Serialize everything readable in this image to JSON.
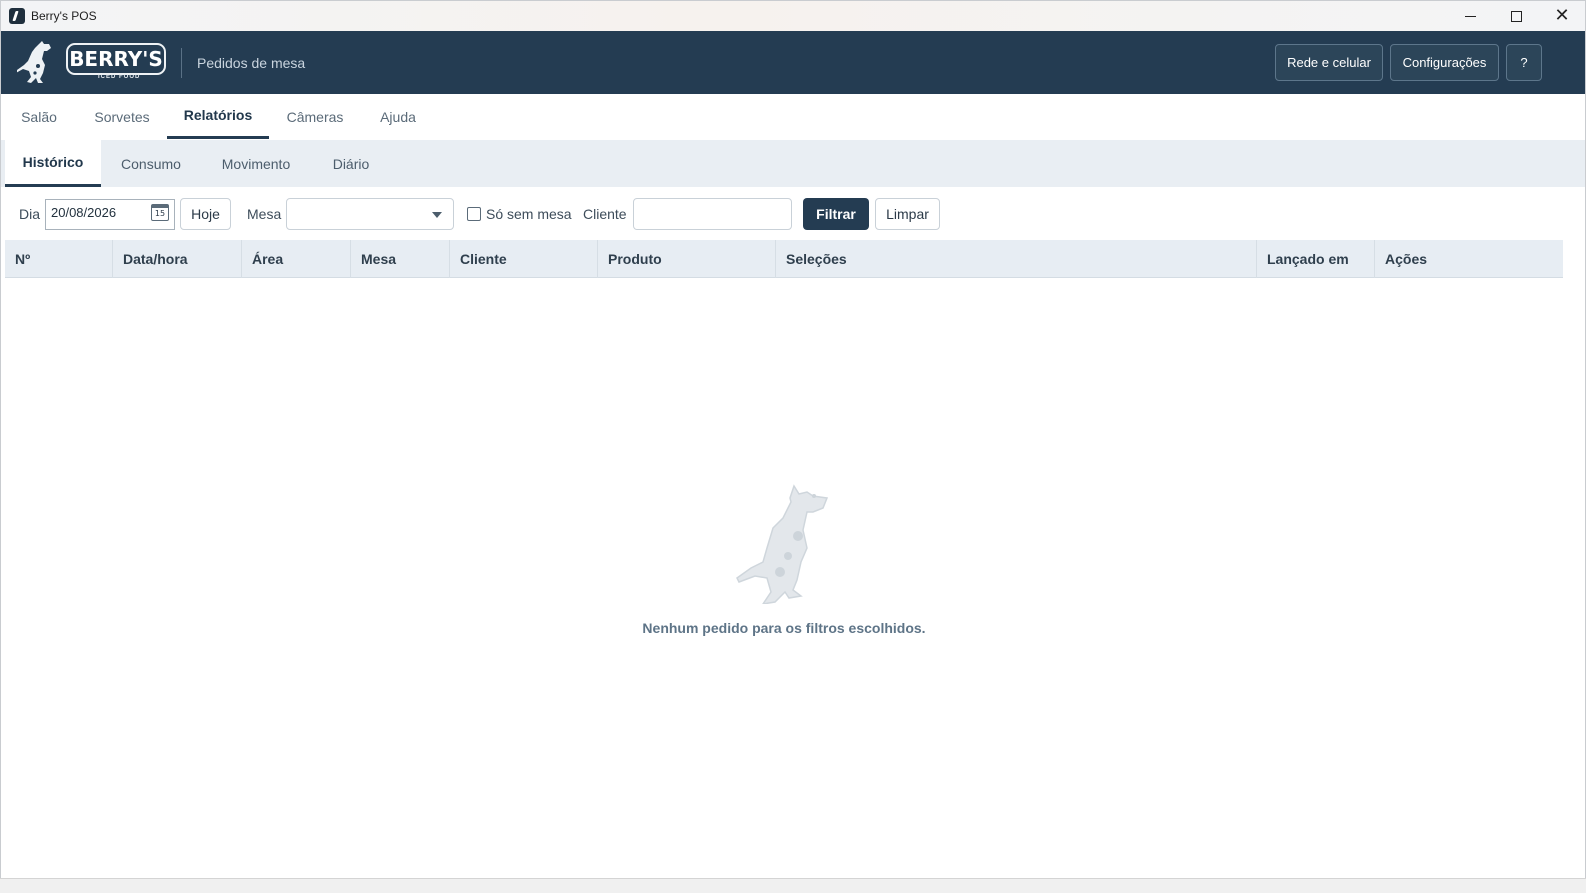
{
  "window": {
    "title": "Berry's POS"
  },
  "header": {
    "logo_text": "BERRY'S",
    "logo_sub": "ICED FOOD",
    "subtitle": "Pedidos de mesa",
    "buttons": [
      "Rede e celular",
      "Configurações",
      "?"
    ]
  },
  "main_tabs": [
    "Salão",
    "Sorvetes",
    "Relatórios",
    "Câmeras",
    "Ajuda"
  ],
  "main_active": "Relatórios",
  "sub_tabs": [
    "Histórico",
    "Consumo",
    "Movimento",
    "Diário"
  ],
  "sub_active": "Histórico",
  "filters": {
    "dia_label": "Dia",
    "date_value": "20/08/2026",
    "calendar_day": "15",
    "hoje_label": "Hoje",
    "mesa_label": "Mesa",
    "mesa_value": "",
    "sem_mesa_label": "Só sem mesa",
    "sem_mesa_checked": false,
    "cliente_label": "Cliente",
    "cliente_value": "",
    "filtrar_label": "Filtrar",
    "limpar_label": "Limpar"
  },
  "table": {
    "columns": [
      "Nº",
      "Data/hora",
      "Área",
      "Mesa",
      "Cliente",
      "Produto",
      "Seleções",
      "Lançado em",
      "Ações"
    ],
    "rows": []
  },
  "empty_message": "Nenhum pedido para os filtros escolhidos.",
  "colors": {
    "header_bg": "#243c52",
    "accent": "#243c52",
    "table_head_bg": "#e7edf3"
  }
}
